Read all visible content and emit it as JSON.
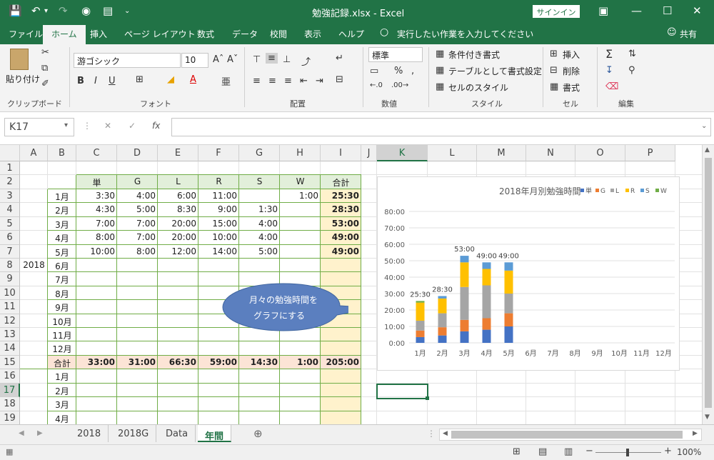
{
  "title": {
    "text": "勉強記録.xlsx  -  Excel",
    "signin": "サインイン"
  },
  "tabs": [
    "ファイル",
    "ホーム",
    "挿入",
    "ページ レイアウト",
    "数式",
    "データ",
    "校閲",
    "表示",
    "ヘルプ"
  ],
  "tell_me": "実行したい作業を入力してください",
  "share": "共有",
  "ribbon": {
    "paste": "貼り付け",
    "clipboard": "クリップボード",
    "font_name": "游ゴシック",
    "font_size": "10",
    "font": "フォント",
    "alignment": "配置",
    "number_format": "標準",
    "number": "数値",
    "cond_format": "条件付き書式",
    "table_format": "テーブルとして書式設定",
    "cell_style": "セルのスタイル",
    "style": "スタイル",
    "insert": "挿入",
    "delete": "削除",
    "format": "書式",
    "cells": "セル",
    "edit": "編集",
    "bold": "B",
    "italic": "I",
    "underline": "U"
  },
  "formula_bar": {
    "name_box": "K17",
    "fx": "fx",
    "value": ""
  },
  "columns": [
    "A",
    "B",
    "C",
    "D",
    "E",
    "F",
    "G",
    "H",
    "I",
    "J",
    "K",
    "L",
    "M",
    "N",
    "O",
    "P"
  ],
  "selected_column": "K",
  "rows": [
    "1",
    "2",
    "3",
    "4",
    "5",
    "6",
    "7",
    "8",
    "9",
    "10",
    "11",
    "12",
    "13",
    "14",
    "15",
    "16",
    "17",
    "18",
    "19"
  ],
  "selected_row": "17",
  "table": {
    "header": [
      "単",
      "G",
      "L",
      "R",
      "S",
      "W",
      "合計"
    ],
    "year": "2018",
    "months": [
      "1月",
      "2月",
      "3月",
      "4月",
      "5月",
      "6月",
      "7月",
      "8月",
      "9月",
      "10月",
      "11月",
      "12月"
    ],
    "data": [
      [
        "3:30",
        "4:00",
        "6:00",
        "11:00",
        "",
        "1:00",
        "25:30"
      ],
      [
        "4:30",
        "5:00",
        "8:30",
        "9:00",
        "1:30",
        "",
        "28:30"
      ],
      [
        "7:00",
        "7:00",
        "20:00",
        "15:00",
        "4:00",
        "",
        "53:00"
      ],
      [
        "8:00",
        "7:00",
        "20:00",
        "10:00",
        "4:00",
        "",
        "49:00"
      ],
      [
        "10:00",
        "8:00",
        "12:00",
        "14:00",
        "5:00",
        "",
        "49:00"
      ]
    ],
    "total_label": "合計",
    "totals": [
      "33:00",
      "31:00",
      "66:30",
      "59:00",
      "14:30",
      "1:00",
      "205:00"
    ],
    "next_months": [
      "1月",
      "2月",
      "3月",
      "4月"
    ]
  },
  "callout": {
    "line1": "月々の勉強時間を",
    "line2": "グラフにする"
  },
  "chart_data": {
    "type": "bar",
    "stacked": true,
    "title": "2018年月別勉強時間",
    "categories": [
      "1月",
      "2月",
      "3月",
      "4月",
      "5月",
      "6月",
      "7月",
      "8月",
      "9月",
      "10月",
      "11月",
      "12月"
    ],
    "series": [
      {
        "name": "単",
        "color": "#4472c4",
        "values": [
          3.5,
          4.5,
          7,
          8,
          10,
          0,
          0,
          0,
          0,
          0,
          0,
          0
        ]
      },
      {
        "name": "G",
        "color": "#ed7d31",
        "values": [
          4,
          5,
          7,
          7,
          8,
          0,
          0,
          0,
          0,
          0,
          0,
          0
        ]
      },
      {
        "name": "L",
        "color": "#a5a5a5",
        "values": [
          6,
          8.5,
          20,
          20,
          12,
          0,
          0,
          0,
          0,
          0,
          0,
          0
        ]
      },
      {
        "name": "R",
        "color": "#ffc000",
        "values": [
          11,
          9,
          15,
          10,
          14,
          0,
          0,
          0,
          0,
          0,
          0,
          0
        ]
      },
      {
        "name": "S",
        "color": "#5b9bd5",
        "values": [
          0,
          1.5,
          4,
          4,
          5,
          0,
          0,
          0,
          0,
          0,
          0,
          0
        ]
      },
      {
        "name": "W",
        "color": "#70ad47",
        "values": [
          1,
          0,
          0,
          0,
          0,
          0,
          0,
          0,
          0,
          0,
          0,
          0
        ]
      }
    ],
    "data_labels": [
      "25:30",
      "28:30",
      "53:00",
      "49:00",
      "49:00",
      "",
      "",
      "",
      "",
      "",
      "",
      ""
    ],
    "yticks": [
      "0:00",
      "10:00",
      "20:00",
      "30:00",
      "40:00",
      "50:00",
      "60:00",
      "70:00",
      "80:00"
    ],
    "ylim": [
      0,
      80
    ],
    "legend": "top-right",
    "grid": true
  },
  "sheets": [
    "2018",
    "2018G",
    "Data",
    "年間"
  ],
  "active_sheet": "年間",
  "zoom": "100%"
}
